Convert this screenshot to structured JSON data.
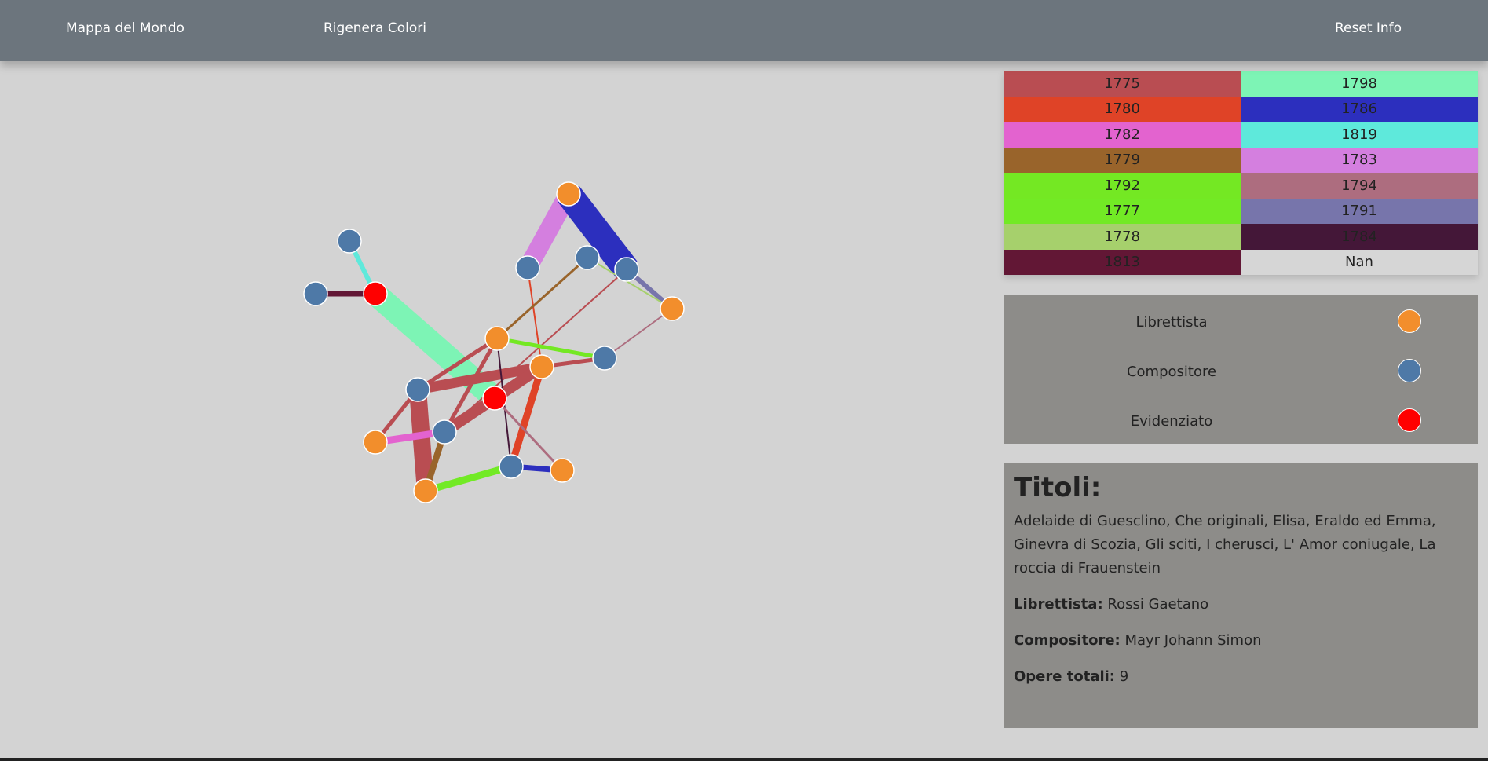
{
  "navbar": {
    "map_label": "Mappa del Mondo",
    "regen_label": "Rigenera Colori",
    "reset_label": "Reset Info"
  },
  "years": [
    {
      "label": "1775",
      "color": "#b94d52"
    },
    {
      "label": "1798",
      "color": "#7df4b5"
    },
    {
      "label": "1780",
      "color": "#df4327"
    },
    {
      "label": "1786",
      "color": "#2c2fbe"
    },
    {
      "label": "1782",
      "color": "#e363cf"
    },
    {
      "label": "1819",
      "color": "#5ee9db"
    },
    {
      "label": "1779",
      "color": "#99642b"
    },
    {
      "label": "1783",
      "color": "#d47fdf"
    },
    {
      "label": "1792",
      "color": "#74e823"
    },
    {
      "label": "1794",
      "color": "#ad6d7f"
    },
    {
      "label": "1777",
      "color": "#72ea25"
    },
    {
      "label": "1791",
      "color": "#7775ab"
    },
    {
      "label": "1778",
      "color": "#a6d06c"
    },
    {
      "label": "1784",
      "color": "#441738"
    },
    {
      "label": "1813",
      "color": "#621735"
    },
    {
      "label": "Nan",
      "color": "#d6d6d6"
    }
  ],
  "legend": {
    "librettista": {
      "label": "Librettista",
      "color": "#f28e2c"
    },
    "compositore": {
      "label": "Compositore",
      "color": "#4e79a7"
    },
    "evidenziato": {
      "label": "Evidenziato",
      "color": "#ff0000"
    }
  },
  "info": {
    "heading": "Titoli:",
    "titles": "Adelaide di Guesclino, Che originali, Elisa, Eraldo ed Emma, Ginevra di Scozia, Gli sciti, I cherusci, L' Amor coniugale, La roccia di Frauenstein",
    "librettista_label": "Librettista:",
    "librettista_value": "Rossi Gaetano",
    "compositore_label": "Compositore:",
    "compositore_value": "Mayr Johann Simon",
    "opere_label": "Opere totali:",
    "opere_value": "9"
  },
  "graph": {
    "nodes": [
      {
        "id": "c1",
        "type": "compositore"
      },
      {
        "id": "c2",
        "type": "compositore"
      },
      {
        "id": "e1",
        "type": "evidenziato"
      },
      {
        "id": "l1",
        "type": "librettista"
      },
      {
        "id": "c3",
        "type": "compositore"
      },
      {
        "id": "c4",
        "type": "compositore"
      },
      {
        "id": "c5",
        "type": "compositore"
      },
      {
        "id": "l2",
        "type": "librettista"
      },
      {
        "id": "l3",
        "type": "librettista"
      },
      {
        "id": "c6",
        "type": "compositore"
      },
      {
        "id": "l4",
        "type": "librettista"
      },
      {
        "id": "c7",
        "type": "compositore"
      },
      {
        "id": "e2",
        "type": "evidenziato"
      },
      {
        "id": "l5",
        "type": "librettista"
      },
      {
        "id": "c8",
        "type": "compositore"
      },
      {
        "id": "l6",
        "type": "librettista"
      },
      {
        "id": "c9",
        "type": "compositore"
      },
      {
        "id": "l7",
        "type": "librettista"
      }
    ],
    "links": [
      {
        "source": "c1",
        "target": "e1",
        "color": "#5ee9db",
        "width": 6
      },
      {
        "source": "c2",
        "target": "e1",
        "color": "#621735",
        "width": 7
      },
      {
        "source": "e1",
        "target": "e2",
        "color": "#7df4b5",
        "width": 30
      },
      {
        "source": "l1",
        "target": "c3",
        "color": "#d47fdf",
        "width": 24
      },
      {
        "source": "l1",
        "target": "c5",
        "color": "#2c2fbe",
        "width": 34
      },
      {
        "source": "c5",
        "target": "l2",
        "color": "#7775ab",
        "width": 6
      },
      {
        "source": "c4",
        "target": "l2",
        "color": "#a6d06c",
        "width": 2
      },
      {
        "source": "c3",
        "target": "l4",
        "color": "#df4327",
        "width": 2
      },
      {
        "source": "c4",
        "target": "l3",
        "color": "#99642b",
        "width": 3
      },
      {
        "source": "l2",
        "target": "c6",
        "color": "#ad6d7f",
        "width": 2
      },
      {
        "source": "c5",
        "target": "c8",
        "color": "#b94d52",
        "width": 2
      },
      {
        "source": "l3",
        "target": "c6",
        "color": "#74e823",
        "width": 5
      },
      {
        "source": "l4",
        "target": "c6",
        "color": "#b94d52",
        "width": 5
      },
      {
        "source": "c7",
        "target": "l4",
        "color": "#b94d52",
        "width": 13
      },
      {
        "source": "c7",
        "target": "l3",
        "color": "#b94d52",
        "width": 5
      },
      {
        "source": "c7",
        "target": "l6",
        "color": "#b94d52",
        "width": 22
      },
      {
        "source": "c7",
        "target": "l5",
        "color": "#b94d52",
        "width": 5
      },
      {
        "source": "l5",
        "target": "c8",
        "color": "#e363cf",
        "width": 9
      },
      {
        "source": "c8",
        "target": "l3",
        "color": "#b94d52",
        "width": 5
      },
      {
        "source": "c8",
        "target": "l4",
        "color": "#b94d52",
        "width": 14
      },
      {
        "source": "c8",
        "target": "l6",
        "color": "#99642b",
        "width": 8
      },
      {
        "source": "l6",
        "target": "c9",
        "color": "#72ea25",
        "width": 9
      },
      {
        "source": "c9",
        "target": "l7",
        "color": "#2c2fbe",
        "width": 7
      },
      {
        "source": "l4",
        "target": "c9",
        "color": "#df4327",
        "width": 9
      },
      {
        "source": "l3",
        "target": "c9",
        "color": "#441738",
        "width": 2
      },
      {
        "source": "e2",
        "target": "l7",
        "color": "#ad6d7f",
        "width": 3
      }
    ]
  }
}
